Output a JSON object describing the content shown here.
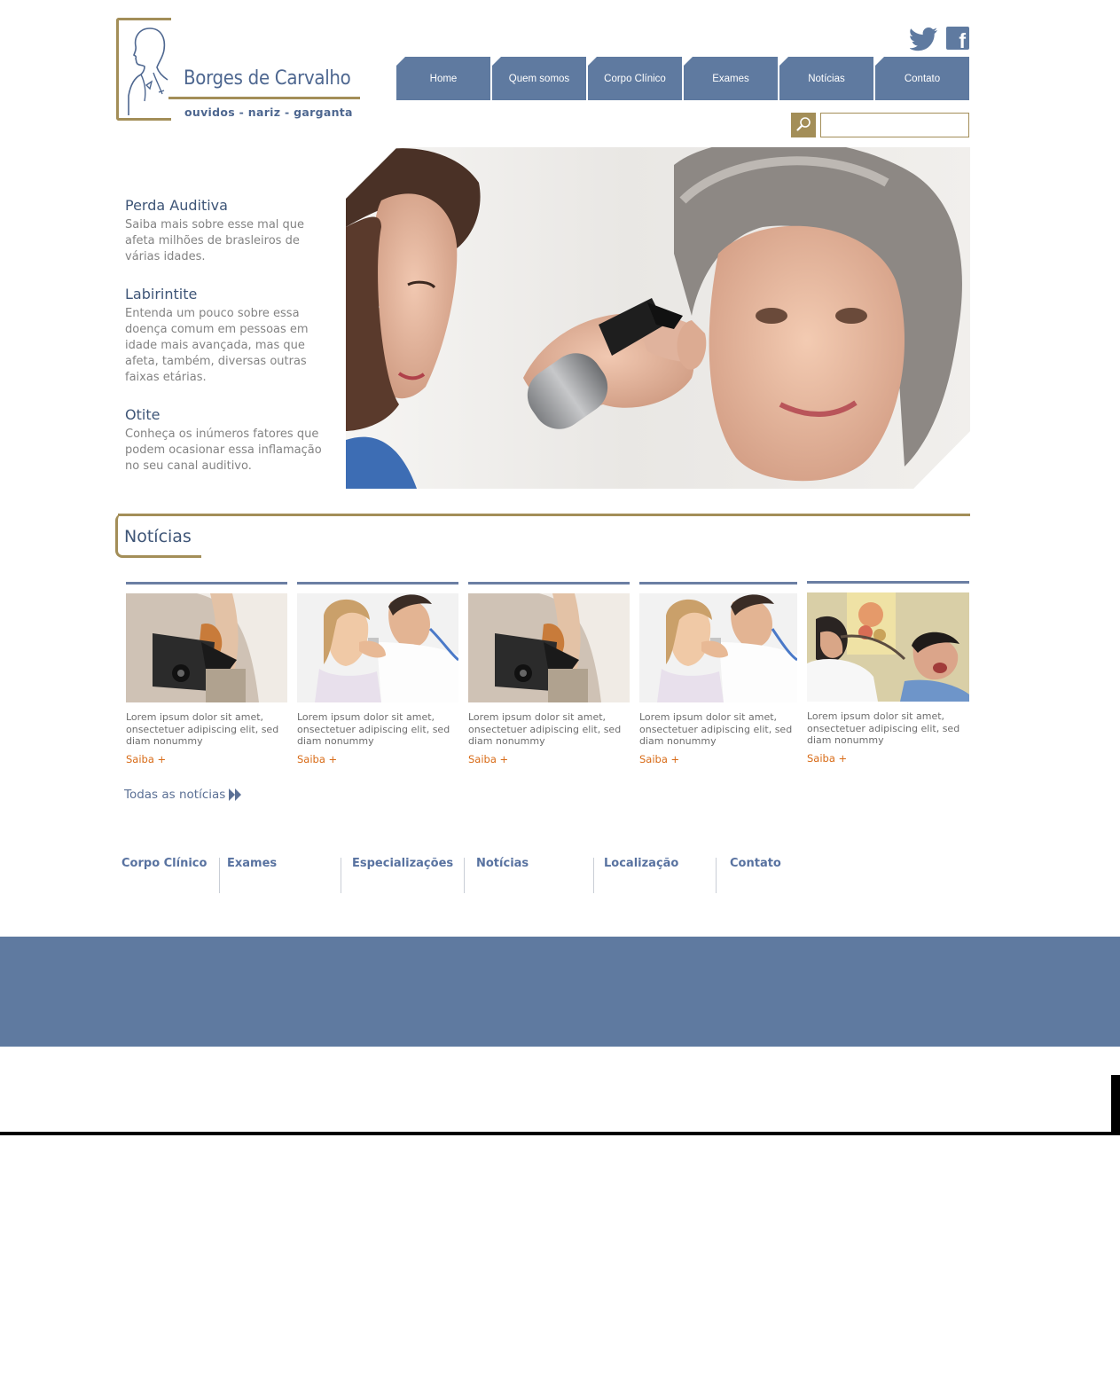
{
  "brand": {
    "name": "Borges de Carvalho",
    "tagline": "ouvidos - nariz - garganta"
  },
  "social": {
    "twitter": "twitter-icon",
    "facebook": "facebook-icon",
    "facebook_letter": "f"
  },
  "nav": {
    "items": [
      {
        "label": "Home"
      },
      {
        "label": "Quem somos"
      },
      {
        "label": "Corpo Clínico"
      },
      {
        "label": "Exames"
      },
      {
        "label": "Notícias"
      },
      {
        "label": "Contato"
      }
    ]
  },
  "search": {
    "placeholder": "",
    "value": ""
  },
  "intro": {
    "topics": [
      {
        "title": "Perda Auditiva",
        "text": "Saiba mais sobre esse mal que afeta milhões de brasleiros de várias idades."
      },
      {
        "title": "Labirintite",
        "text": "Entenda um pouco sobre essa doença comum em pessoas em idade mais avançada, mas que afeta, também, diversas outras faixas etárias."
      },
      {
        "title": "Otite",
        "text": "Conheça os inúmeros fatores que podem ocasionar essa inflamação no seu canal auditivo."
      }
    ]
  },
  "news": {
    "title": "Notícias",
    "items": [
      {
        "text": "Lorem ipsum dolor sit amet, onsectetuer adipiscing elit, sed diam nonummy",
        "link": "Saiba +"
      },
      {
        "text": "Lorem ipsum dolor sit amet, onsectetuer adipiscing elit, sed diam nonummy",
        "link": "Saiba +"
      },
      {
        "text": "Lorem ipsum dolor sit amet, onsectetuer adipiscing elit, sed diam nonummy",
        "link": "Saiba +"
      },
      {
        "text": "Lorem ipsum dolor sit amet, onsectetuer adipiscing elit, sed diam nonummy",
        "link": "Saiba +"
      },
      {
        "text": "Lorem ipsum dolor sit amet, onsectetuer adipiscing elit, sed diam nonummy",
        "link": "Saiba +"
      }
    ],
    "all_link": "Todas as notícias"
  },
  "footer": {
    "links": [
      {
        "label": "Corpo Clínico"
      },
      {
        "label": "Exames"
      },
      {
        "label": "Especializações"
      },
      {
        "label": "Notícias"
      },
      {
        "label": "Localização"
      },
      {
        "label": "Contato"
      }
    ]
  },
  "colors": {
    "brand_blue": "#5f7aa0",
    "brand_gold": "#a38e58",
    "link_orange": "#d86b17",
    "title_blue": "#3e5577"
  }
}
